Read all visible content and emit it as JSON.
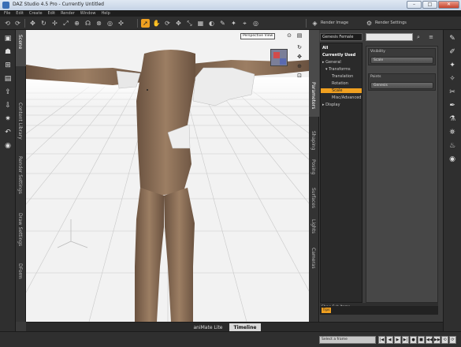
{
  "window": {
    "title": "DAZ Studio 4.5 Pro - Currently Untitled",
    "min": "–",
    "max": "□",
    "close": "✕"
  },
  "menubar": [
    "File",
    "Edit",
    "Create",
    "Edit",
    "Render",
    "Window",
    "Help"
  ],
  "toolbar": {
    "render_label": "Render Image",
    "settings_label": "Render Settings"
  },
  "left_tabs": [
    "Scene",
    "Content Library",
    "Render Settings",
    "Draw Settings",
    "DForm"
  ],
  "right_tabs": [
    "Parameters",
    "Shaping",
    "Posing",
    "Surfaces",
    "Lights",
    "Cameras"
  ],
  "viewport": {
    "camera": "Perspective View",
    "camera_icon": "camera-icon",
    "menu_icon": "menu-icon"
  },
  "parameters": {
    "selector": "Genesis Female",
    "search_placeholder": "",
    "tree": [
      {
        "label": "All",
        "style": "bold"
      },
      {
        "label": "Currently Used",
        "style": "bold"
      },
      {
        "label": "▸ General",
        "style": ""
      },
      {
        "label": "▾ Transforms",
        "style": ""
      },
      {
        "label": "Translation",
        "style": ""
      },
      {
        "label": "Rotation",
        "style": ""
      },
      {
        "label": "Scale",
        "style": "hl"
      },
      {
        "label": "Misc/Advanced",
        "style": ""
      },
      {
        "label": "▸ Display",
        "style": ""
      }
    ],
    "groups": [
      {
        "header": "Visibility",
        "value": "Scale"
      },
      {
        "header": "Points",
        "value": "Genesis"
      }
    ],
    "show_sub_items": "Show Sub Items",
    "tip_button": "Tips"
  },
  "bottom_tabs": [
    "aniMate Lite",
    "Timeline"
  ],
  "statusbar": {
    "field": "Select a frame",
    "buttons": [
      "|◀",
      "◀",
      "▶",
      "▶|",
      "●",
      "■",
      "◀◀",
      "▶▶",
      "⟲",
      "⟳"
    ]
  },
  "colors": {
    "accent": "#f0a020",
    "viewport_bg": "#f2f2f2",
    "skin": "#8a6e55"
  }
}
